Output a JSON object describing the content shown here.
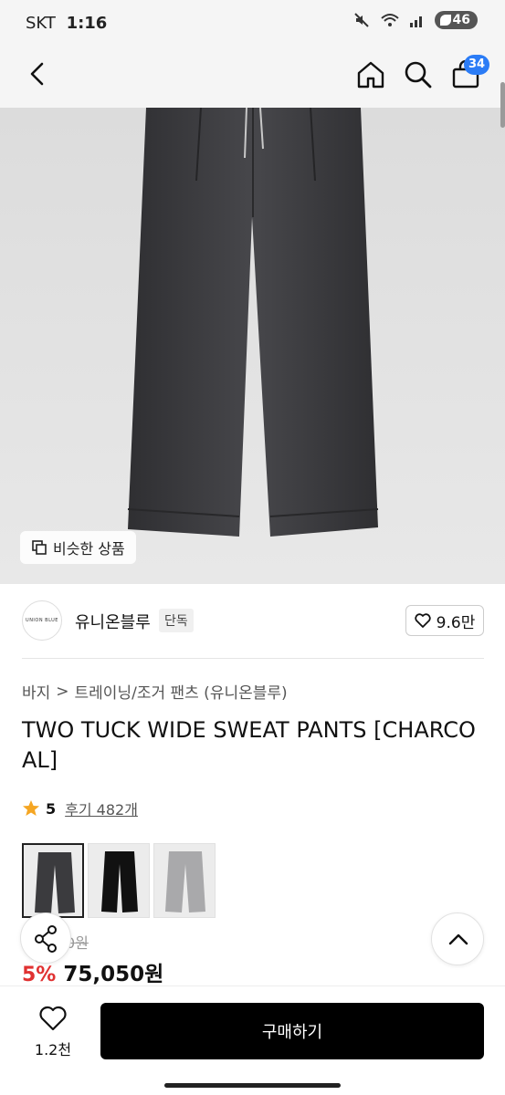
{
  "status_bar": {
    "carrier": "SKT",
    "time": "1:16",
    "battery": "46"
  },
  "header": {
    "cart_count": "34"
  },
  "image": {
    "similar_label": "비슷한 상품"
  },
  "brand": {
    "logo_text": "UNION BLUE",
    "name": "유니온블루",
    "badge": "단독",
    "likes": "9.6만"
  },
  "breadcrumb": {
    "category": "바지",
    "separator": ">",
    "subcategory": "트레이닝/조거 팬츠 (유니온블루)"
  },
  "product": {
    "title": "TWO TUCK WIDE SWEAT PANTS [CHARCOAL]"
  },
  "rating": {
    "score": "5",
    "reviews": "후기 482개"
  },
  "colors": [
    {
      "name": "charcoal",
      "hex": "#3b3b3e"
    },
    {
      "name": "black",
      "hex": "#111111"
    },
    {
      "name": "gray",
      "hex": "#a9a9ab"
    }
  ],
  "price": {
    "original": "0원",
    "discount": "5%",
    "final": "75,050원"
  },
  "bottom_bar": {
    "wish_count": "1.2천",
    "buy_label": "구매하기"
  }
}
